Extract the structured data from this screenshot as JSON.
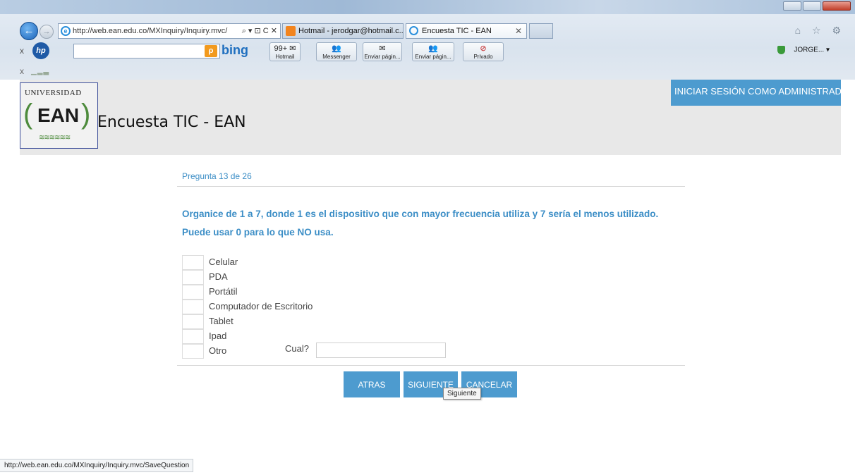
{
  "browser": {
    "address_url": "http://web.ean.edu.co/MXInquiry/Inquiry.mvc/",
    "address_tools": "⌕ ▾ ⊡ C ✕",
    "tabs": [
      {
        "label": "Hotmail - jerodgar@hotmail.c...",
        "active": false,
        "icon_color": "#f2841e"
      },
      {
        "label": "Encuesta TIC - EAN",
        "active": true,
        "icon_color": "#2a8fdc"
      }
    ],
    "tab_close": "✕",
    "right_icons": "⌂ ☆ ⚙"
  },
  "toolbar": {
    "close_glyph": "x",
    "hp_logo": "hp",
    "search_icon": "search-icon",
    "search_glyph": "ρ",
    "bing_label": "bing",
    "buttons": [
      {
        "label": "Hotmail",
        "glyph": "99+ ✉"
      },
      {
        "label": "Messenger",
        "glyph": "👥"
      },
      {
        "label": "Enviar págin...",
        "glyph": "✉"
      },
      {
        "label": "Enviar págin...",
        "glyph": "👥"
      },
      {
        "label": "Privado",
        "glyph": "⊘"
      }
    ],
    "user_label": "JORGE... ▾"
  },
  "row3": {
    "close_glyph": "x",
    "bars": "▁▂▃"
  },
  "header": {
    "logo_top": "UNIVERSIDAD",
    "logo_main": "EAN",
    "site_title": "Encuesta TIC - EAN",
    "admin_button": "INICIAR SESIÓN COMO ADMINISTRADOR"
  },
  "survey": {
    "counter": "Pregunta 13 de 26",
    "question": "Organice de 1 a 7, donde 1 es el dispositivo que con mayor frecuencia utiliza y 7 sería el menos utilizado. Puede usar 0 para lo que NO usa.",
    "options": [
      "Celular",
      "PDA",
      "Portátil",
      "Computador de Escritorio",
      "Tablet",
      "Ipad",
      "Otro"
    ],
    "other_label": "Cual?",
    "other_value": ""
  },
  "buttons": {
    "back": "ATRAS",
    "next": "SIGUIENTE",
    "cancel": "CANCELAR",
    "tooltip": "Siguiente"
  },
  "status": {
    "url": "http://web.ean.edu.co/MXInquiry/Inquiry.mvc/SaveQuestion"
  },
  "colors": {
    "accent": "#4d9bcf",
    "question_text": "#3c8ec6",
    "header_bg": "#e8e8e8"
  }
}
